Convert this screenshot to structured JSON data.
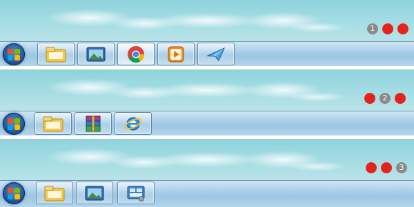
{
  "panels": [
    {
      "number": "1",
      "apps": [
        "explorer-icon",
        "photo-viewer-icon",
        "chrome-icon",
        "media-player-icon",
        "paper-plane-icon"
      ]
    },
    {
      "number": "2",
      "apps": [
        "explorer-icon",
        "winrar-icon",
        "internet-explorer-icon"
      ]
    },
    {
      "number": "3",
      "apps": [
        "explorer-icon",
        "photo-viewer-icon",
        "control-panel-icon"
      ]
    }
  ],
  "colors": {
    "red_dot": "#e5231d",
    "number_badge": "#8a8a8a"
  }
}
